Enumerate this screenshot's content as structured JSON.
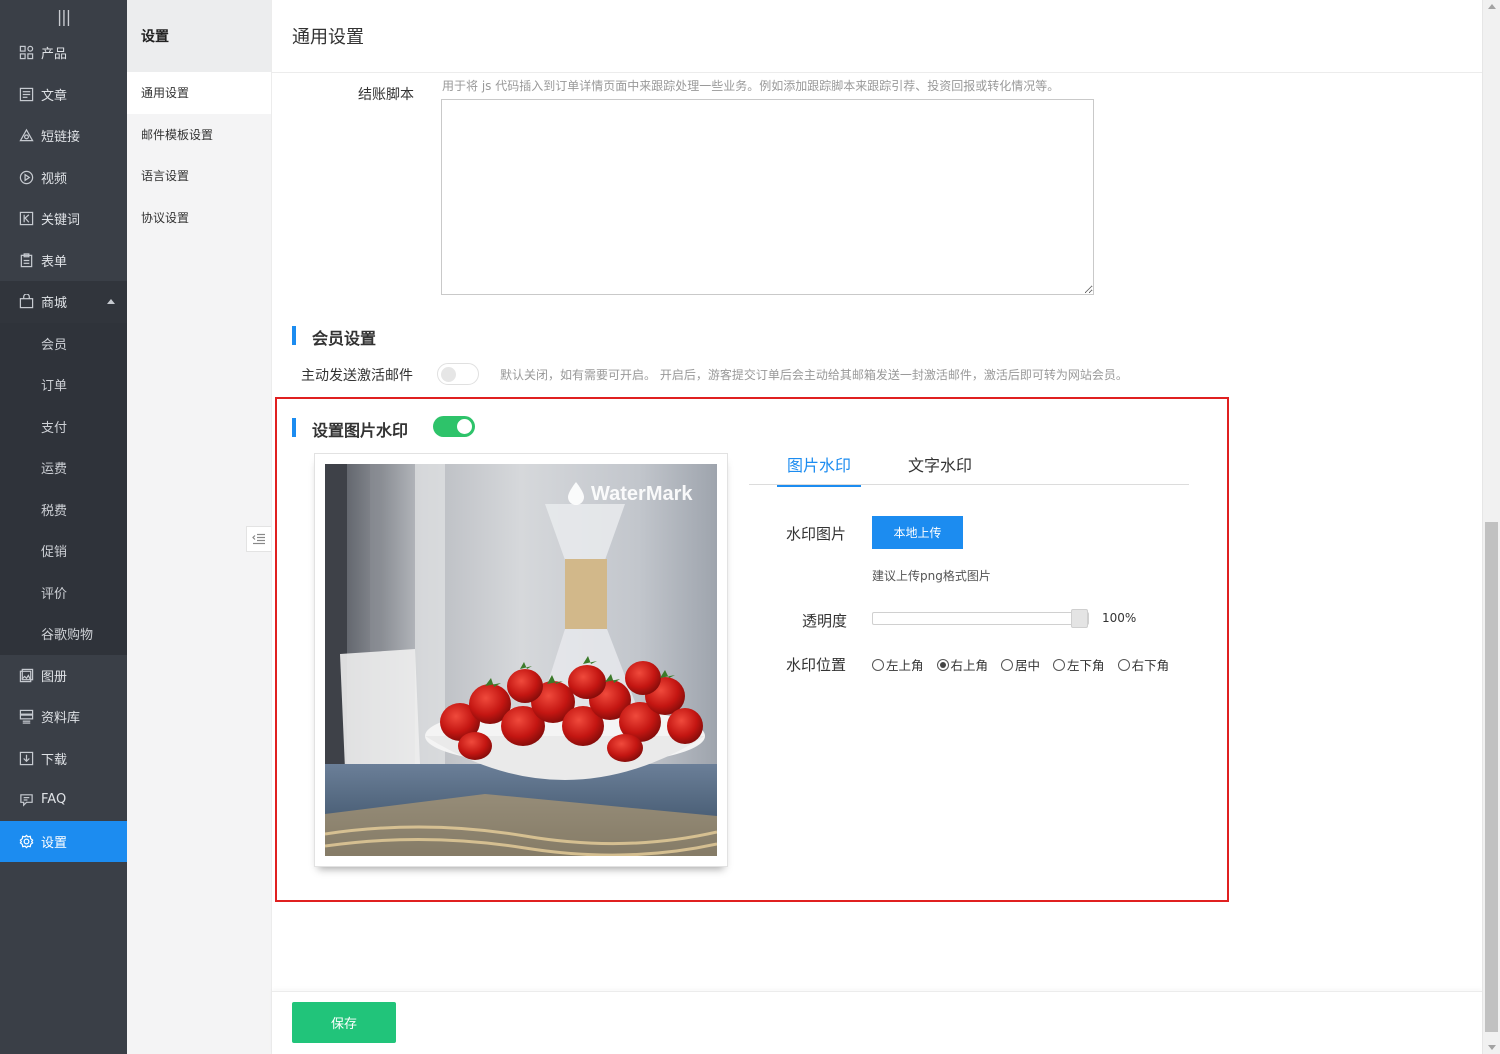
{
  "sidebar": {
    "collapse_icon": "vertical-bars-icon",
    "items": [
      {
        "label": "产品",
        "icon": "grid-icon"
      },
      {
        "label": "文章",
        "icon": "article-icon"
      },
      {
        "label": "短链接",
        "icon": "link-triangle-icon"
      },
      {
        "label": "视频",
        "icon": "play-icon"
      },
      {
        "label": "关键词",
        "icon": "keyword-icon"
      },
      {
        "label": "表单",
        "icon": "clipboard-icon"
      },
      {
        "label": "商城",
        "icon": "bag-icon",
        "expanded": true
      },
      {
        "label": "图册",
        "icon": "album-icon"
      },
      {
        "label": "资料库",
        "icon": "database-icon"
      },
      {
        "label": "下载",
        "icon": "download-icon"
      },
      {
        "label": "FAQ",
        "icon": "chat-icon"
      },
      {
        "label": "设置",
        "icon": "gear-icon",
        "active": true
      }
    ],
    "shop_sub_items": [
      "会员",
      "订单",
      "支付",
      "运费",
      "税费",
      "促销",
      "评价",
      "谷歌购物"
    ],
    "active_color": "#1c8cf0"
  },
  "submenu": {
    "title": "设置",
    "items": [
      "通用设置",
      "邮件模板设置",
      "语言设置",
      "协议设置"
    ],
    "active_index": 0
  },
  "page": {
    "title": "通用设置"
  },
  "checkout_script": {
    "label": "结账脚本",
    "hint": "用于将 js 代码插入到订单详情页面中来跟踪处理一些业务。例如添加跟踪脚本来跟踪引荐、投资回报或转化情况等。",
    "value": ""
  },
  "member": {
    "section_title": "会员设置",
    "activate_label": "主动发送激活邮件",
    "activate_enabled": false,
    "activate_hint": "默认关闭，如有需要可开启。 开启后，游客提交订单后会主动给其邮箱发送一封激活邮件，激活后即可转为网站会员。"
  },
  "watermark": {
    "section_title": "设置图片水印",
    "enabled": true,
    "toggle_color": "#2ec36a",
    "preview_text": "WaterMark",
    "tabs": [
      "图片水印",
      "文字水印"
    ],
    "active_tab": 0,
    "image_label": "水印图片",
    "upload_label": "本地上传",
    "upload_hint": "建议上传png格式图片",
    "opacity_label": "透明度",
    "opacity_value": "100%",
    "opacity_fraction": 1.0,
    "position_label": "水印位置",
    "positions": [
      "左上角",
      "右上角",
      "居中",
      "左下角",
      "右下角"
    ],
    "position_selected": 1
  },
  "footer": {
    "save_label": "保存",
    "save_color": "#21c47a"
  }
}
